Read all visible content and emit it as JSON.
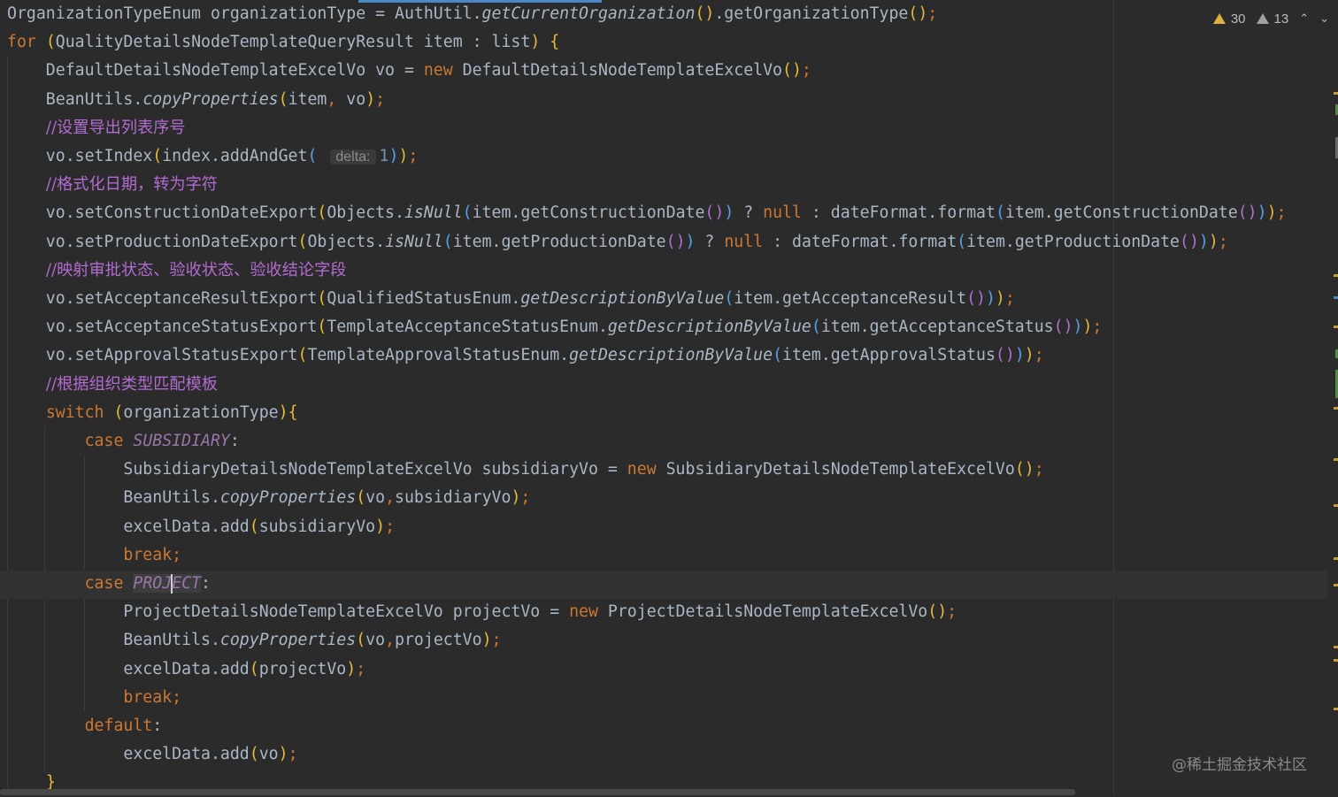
{
  "inspection": {
    "warnings": "30",
    "weak_warnings": "13"
  },
  "watermark": "@稀土掘金技术社区",
  "hint": {
    "delta": "delta:"
  },
  "lines": [
    {
      "text": "OrganizationTypeEnum organizationType = AuthUtil.getCurrentOrganization().getOrganizationType();"
    },
    {
      "text": "for (QualityDetailsNodeTemplateQueryResult item : list) {"
    },
    {
      "text": "    DefaultDetailsNodeTemplateExcelVo vo = new DefaultDetailsNodeTemplateExcelVo();"
    },
    {
      "text": "    BeanUtils.copyProperties(item, vo);"
    },
    {
      "text": "    //设置导出列表序号"
    },
    {
      "text": "    vo.setIndex(index.addAndGet( delta: 1));"
    },
    {
      "text": "    //格式化日期，转为字符"
    },
    {
      "text": "    vo.setConstructionDateExport(Objects.isNull(item.getConstructionDate()) ? null : dateFormat.format(item.getConstructionDate()));"
    },
    {
      "text": "    vo.setProductionDateExport(Objects.isNull(item.getProductionDate()) ? null : dateFormat.format(item.getProductionDate()));"
    },
    {
      "text": "    //映射审批状态、验收状态、验收结论字段"
    },
    {
      "text": "    vo.setAcceptanceResultExport(QualifiedStatusEnum.getDescriptionByValue(item.getAcceptanceResult()));"
    },
    {
      "text": "    vo.setAcceptanceStatusExport(TemplateAcceptanceStatusEnum.getDescriptionByValue(item.getAcceptanceStatus()));"
    },
    {
      "text": "    vo.setApprovalStatusExport(TemplateApprovalStatusEnum.getDescriptionByValue(item.getApprovalStatus()));"
    },
    {
      "text": "    //根据组织类型匹配模板"
    },
    {
      "text": "    switch (organizationType){"
    },
    {
      "text": "        case SUBSIDIARY:"
    },
    {
      "text": "            SubsidiaryDetailsNodeTemplateExcelVo subsidiaryVo = new SubsidiaryDetailsNodeTemplateExcelVo();"
    },
    {
      "text": "            BeanUtils.copyProperties(vo,subsidiaryVo);"
    },
    {
      "text": "            excelData.add(subsidiaryVo);"
    },
    {
      "text": "            break;"
    },
    {
      "text": "        case PROJECT:"
    },
    {
      "text": "            ProjectDetailsNodeTemplateExcelVo projectVo = new ProjectDetailsNodeTemplateExcelVo();"
    },
    {
      "text": "            BeanUtils.copyProperties(vo,projectVo);"
    },
    {
      "text": "            excelData.add(projectVo);"
    },
    {
      "text": "            break;"
    },
    {
      "text": "        default:"
    },
    {
      "text": "            excelData.add(vo);"
    },
    {
      "text": "    }"
    }
  ],
  "colors": {
    "background": "#2b2b2b",
    "keyword": "#cc7832",
    "identifier": "#a9b7c6",
    "comment": "#b26bd1",
    "constant": "#9876aa",
    "number": "#6897bb"
  }
}
